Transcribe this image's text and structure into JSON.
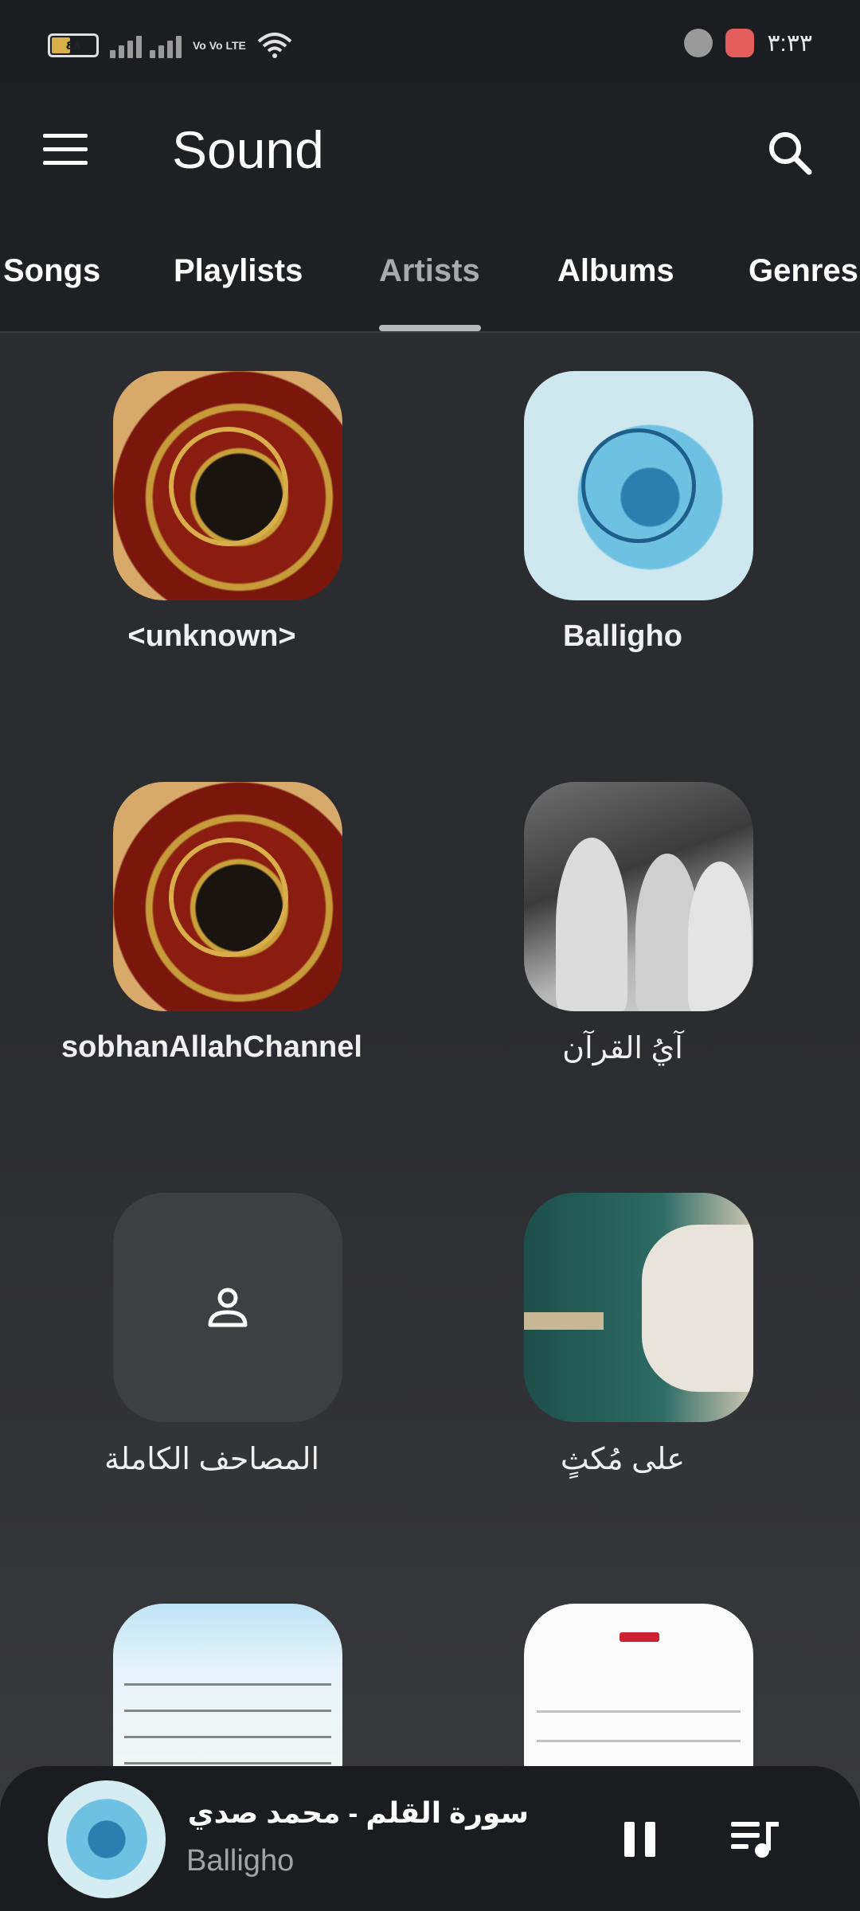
{
  "status_bar": {
    "battery_level": "٤٨",
    "network_label": "Vo Vo LTE",
    "time": "٣:٣٣",
    "icons": [
      "battery-icon",
      "signal-icon",
      "wifi-icon",
      "notification-icon",
      "app-notification-icon"
    ]
  },
  "header": {
    "title": "Sound",
    "menu_icon": "menu-icon",
    "search_icon": "search-icon"
  },
  "tabs": [
    {
      "label": "Songs",
      "active": false
    },
    {
      "label": "Playlists",
      "active": false
    },
    {
      "label": "Artists",
      "active": true
    },
    {
      "label": "Albums",
      "active": false
    },
    {
      "label": "Genres",
      "active": false
    }
  ],
  "artists": [
    {
      "name": "<unknown>",
      "art": "quran-cover-red"
    },
    {
      "name": "Balligho",
      "art": "quran-cover-blue"
    },
    {
      "name": "sobhanAllahChannel",
      "art": "quran-cover-red"
    },
    {
      "name": "آيُ القرآن",
      "art": "mosque-photo"
    },
    {
      "name": "المصاحف الكاملة",
      "art": "artist-placeholder-icon"
    },
    {
      "name": "على مُكثٍ",
      "art": "reciter-photo"
    },
    {
      "name": "",
      "art": "mushaf-page"
    },
    {
      "name": "",
      "art": "text-page"
    }
  ],
  "player": {
    "title": "سورة القلم - محمد صدي...",
    "artist": "Balligho",
    "pause_icon": "pause-icon",
    "queue_icon": "queue-icon"
  },
  "colors": {
    "background": "#2a2b2e",
    "bar": "#1f2023",
    "active_tab": "#a9aaad",
    "accent_indicator": "#b8b9bc"
  }
}
